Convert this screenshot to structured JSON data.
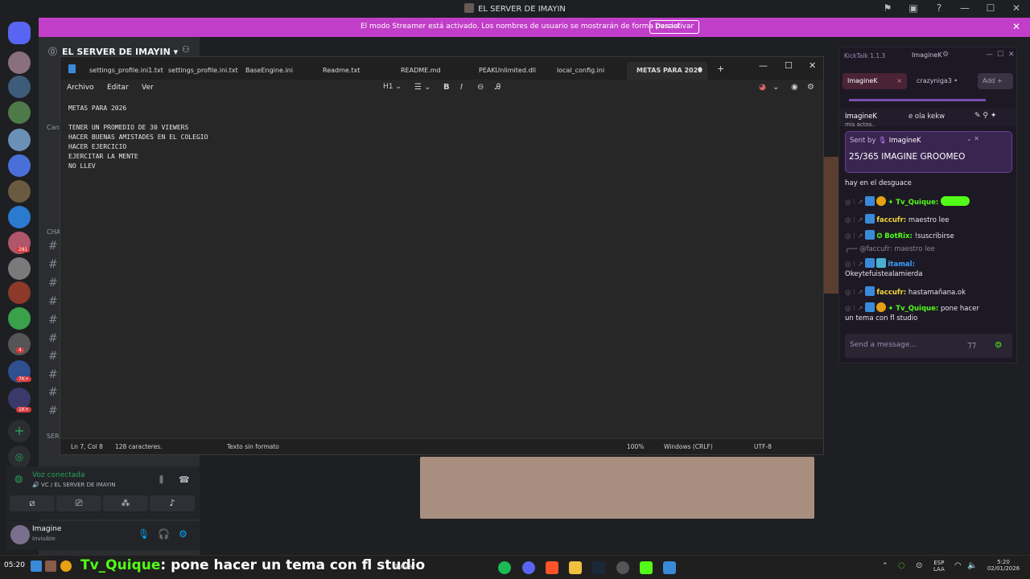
{
  "titlebar": {
    "title": "EL SERVER DE IMAYIN"
  },
  "banner": {
    "message": "El modo Streamer está activado. Los nombres de usuario se mostrarán de forma parcial.",
    "button": "Desactivar"
  },
  "server": {
    "name": "EL SERVER DE IMAYIN",
    "category_chat": "CHA",
    "category_ser": "SER",
    "category_can": "Can"
  },
  "rail": {
    "badges": [
      "281",
      "4",
      "7K+",
      "1K+"
    ]
  },
  "voice": {
    "status": "Voz conectada",
    "channel": "🔊 VC / EL SERVER DE IMAYIN"
  },
  "user": {
    "name": "Imagine",
    "status": "Invisible"
  },
  "notepad": {
    "tabs": [
      "settings_profile.ini1.txt",
      "settings_profile.ini.txt",
      "BaseEngine.ini",
      "Readme.txt",
      "README.md",
      "PEAKUnlimited.dll",
      "local_config.ini",
      "METAS PARA 2026"
    ],
    "menu": [
      "Archivo",
      "Editar",
      "Ver"
    ],
    "heading_label": "H1",
    "lines": [
      "METAS PARA 2026",
      "",
      "TENER UN PROMEDIO DE 30 VIEWERS",
      "HACER BUENAS AMISTADES EN EL COLEGIO",
      "HACER EJERCICIO",
      "EJERCITAR LA MENTE",
      "NO LLEV"
    ],
    "status": {
      "position": "Ln 7, Col 8",
      "chars": "128 caracteres.",
      "format": "Texto sin formato",
      "zoom": "100%",
      "eol": "Windows (CRLF)",
      "encoding": "UTF-8"
    }
  },
  "kicktalk": {
    "version": "KickTalk 1.1.3",
    "user": "ImagineK",
    "chip_active": "ImagineK",
    "chip_other": "crazyniga3",
    "add": "Add",
    "chat_user": "ImagineK",
    "chat_preview": "e ola kekw",
    "clipped": "mis actos..",
    "pinned_by": "Sent by",
    "pinned_user": "ImagineK",
    "pinned_msg": "25/365 IMAGINE GROOMEO",
    "messages": [
      {
        "text": "hay en el desguace"
      },
      {
        "nick": "Tv_Quique:",
        "text": ""
      },
      {
        "nick": "faccufr:",
        "text": "maestro lee"
      },
      {
        "nick": "BotRix:",
        "text": "!suscribirse"
      },
      {
        "reply": "@faccufr: maestro lee"
      },
      {
        "nick": "itamal:",
        "text": ""
      },
      {
        "text": "Okeytefuistealamierda"
      },
      {
        "nick": "faccufr:",
        "text": "hastamañana.ok"
      },
      {
        "nick": "Tv_Quique:",
        "text": "pone hacer"
      },
      {
        "text": "un tema con fl studio"
      }
    ],
    "send_placeholder": "Send a message..."
  },
  "taskbar": {
    "ticker_time": "05:20",
    "ticker_nick": "Tv_Quique",
    "ticker_msg": ": pone hacer un tema con fl studio",
    "search": "Buscar",
    "lang1": "ESP",
    "lang2": "LAA",
    "time": "5:20",
    "date": "02/01/2026"
  },
  "colors": {
    "discord_bg": "#1e1f22",
    "banner": "#c13ec9",
    "kick_green": "#53fc18",
    "chat_nick": "#f2d440"
  }
}
